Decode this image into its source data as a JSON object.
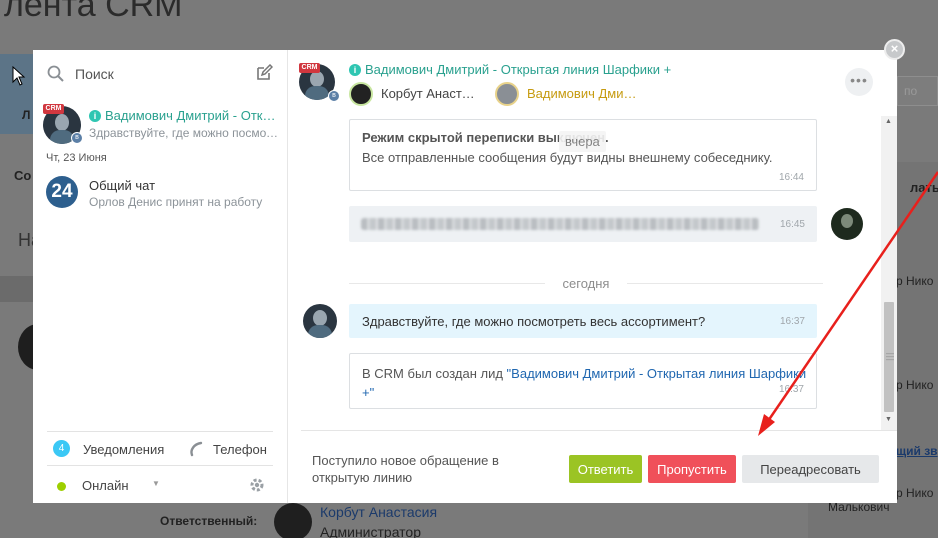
{
  "background": {
    "page_title": "лента CRM",
    "left_label_1": "Л",
    "left_label_2": "Со",
    "left_label_3": "На",
    "right_search_placeholder": "по",
    "right_heading": "лать",
    "right_text_1": "р Нико",
    "right_text_2": "р Нико",
    "right_link": "щий зв",
    "right_text_3": "р Нико",
    "right_text_4": "Малькович",
    "responsible_label": "Ответственный:",
    "responsible_name": "Корбут Анастасия",
    "responsible_role": "Администратор"
  },
  "sidebar": {
    "search_placeholder": "Поиск",
    "chats": [
      {
        "title": "Вадимович Дмитрий - Открытая линия Шарфики +",
        "subtitle": "Здравствуйте, где можно посмотреть весь ассортимент?",
        "crm_tag": "CRM"
      },
      {
        "avatar_text": "24",
        "title": "Общий чат",
        "subtitle": "Орлов Денис принят на работу"
      }
    ],
    "date_separator": "Чт, 23 Июня",
    "notifications_count": "4",
    "notifications_label": "Уведомления",
    "phone_label": "Телефон",
    "status_label": "Онлайн"
  },
  "chat": {
    "crm_tag": "CRM",
    "title": "Вадимович Дмитрий - Открытая линия Шарфики +",
    "users": [
      {
        "name": "Корбут Анастасия"
      },
      {
        "name": "Вадимович Дмитрий"
      }
    ],
    "messages": {
      "hidden_mode_title": "Режим скрытой переписки выключен.",
      "hidden_mode_text": "Все отправленные сообщения будут видны внешнему собеседнику.",
      "hidden_mode_time": "16:44",
      "day_yesterday": "вчера",
      "blurred_time": "16:45",
      "day_today": "сегодня",
      "incoming_text": "Здравствуйте, где можно посмотреть весь ассортимент?",
      "incoming_time": "16:37",
      "crm_prefix": "В CRM был создан лид ",
      "crm_link": "\"Вадимович Дмитрий - Открытая линия Шарфики +\"",
      "crm_time": "16:37"
    },
    "footer": {
      "notice": "Поступило новое обращение в открытую линию",
      "answer_label": "Ответить",
      "skip_label": "Пропустить",
      "forward_label": "Переадресовать"
    }
  },
  "colors": {
    "accent_teal": "#2aa18f",
    "answer_green": "#9bc424",
    "skip_red": "#f0505a",
    "annotation_arrow": "#e8201c"
  }
}
